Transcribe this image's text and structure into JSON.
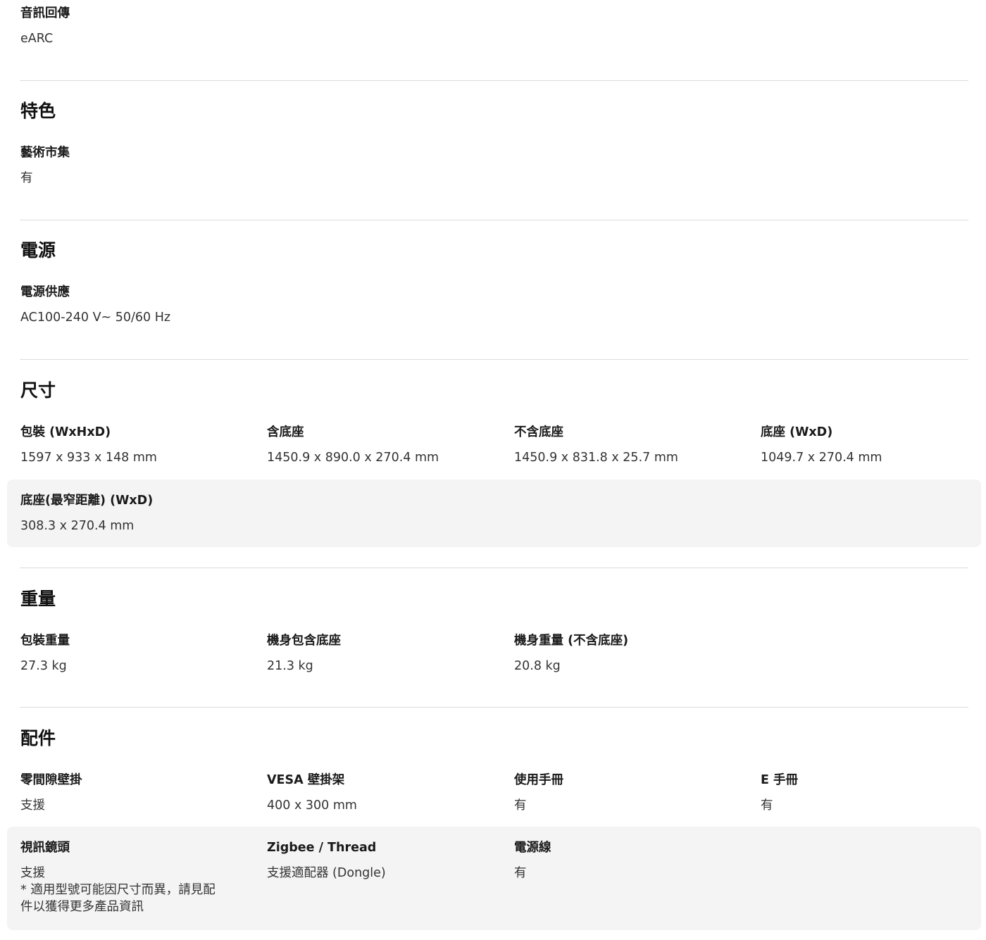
{
  "audio_return": {
    "label": "音訊回傳",
    "value": "eARC"
  },
  "features": {
    "title": "特色",
    "items": [
      {
        "label": "藝術市集",
        "value": "有"
      }
    ]
  },
  "power": {
    "title": "電源",
    "items": [
      {
        "label": "電源供應",
        "value": "AC100-240 V~ 50/60 Hz"
      }
    ]
  },
  "dimensions": {
    "title": "尺寸",
    "items": [
      {
        "label": "包裝 (WxHxD)",
        "value": "1597 x 933 x 148 mm"
      },
      {
        "label": "含底座",
        "value": "1450.9 x 890.0 x 270.4 mm"
      },
      {
        "label": "不含底座",
        "value": "1450.9 x 831.8 x 25.7 mm"
      },
      {
        "label": "底座 (WxD)",
        "value": "1049.7 x 270.4 mm"
      },
      {
        "label": "底座(最窄距離) (WxD)",
        "value": "308.3 x 270.4 mm"
      }
    ]
  },
  "weight": {
    "title": "重量",
    "items": [
      {
        "label": "包裝重量",
        "value": "27.3 kg"
      },
      {
        "label": "機身包含底座",
        "value": "21.3 kg"
      },
      {
        "label": "機身重量 (不含底座)",
        "value": "20.8 kg"
      }
    ]
  },
  "accessories": {
    "title": "配件",
    "items": [
      {
        "label": "零間隙壁掛",
        "value": "支援"
      },
      {
        "label": "VESA 壁掛架",
        "value": "400 x 300 mm"
      },
      {
        "label": "使用手冊",
        "value": "有"
      },
      {
        "label": "E 手冊",
        "value": "有"
      },
      {
        "label": "視訊鏡頭",
        "value": "支援",
        "note_line1": "* 適用型號可能因尺寸而異，請見配",
        "note_line2": "件以獲得更多產品資訊"
      },
      {
        "label": "Zigbee / Thread",
        "value": "支援適配器 (Dongle)"
      },
      {
        "label": "電源線",
        "value": "有"
      }
    ]
  }
}
